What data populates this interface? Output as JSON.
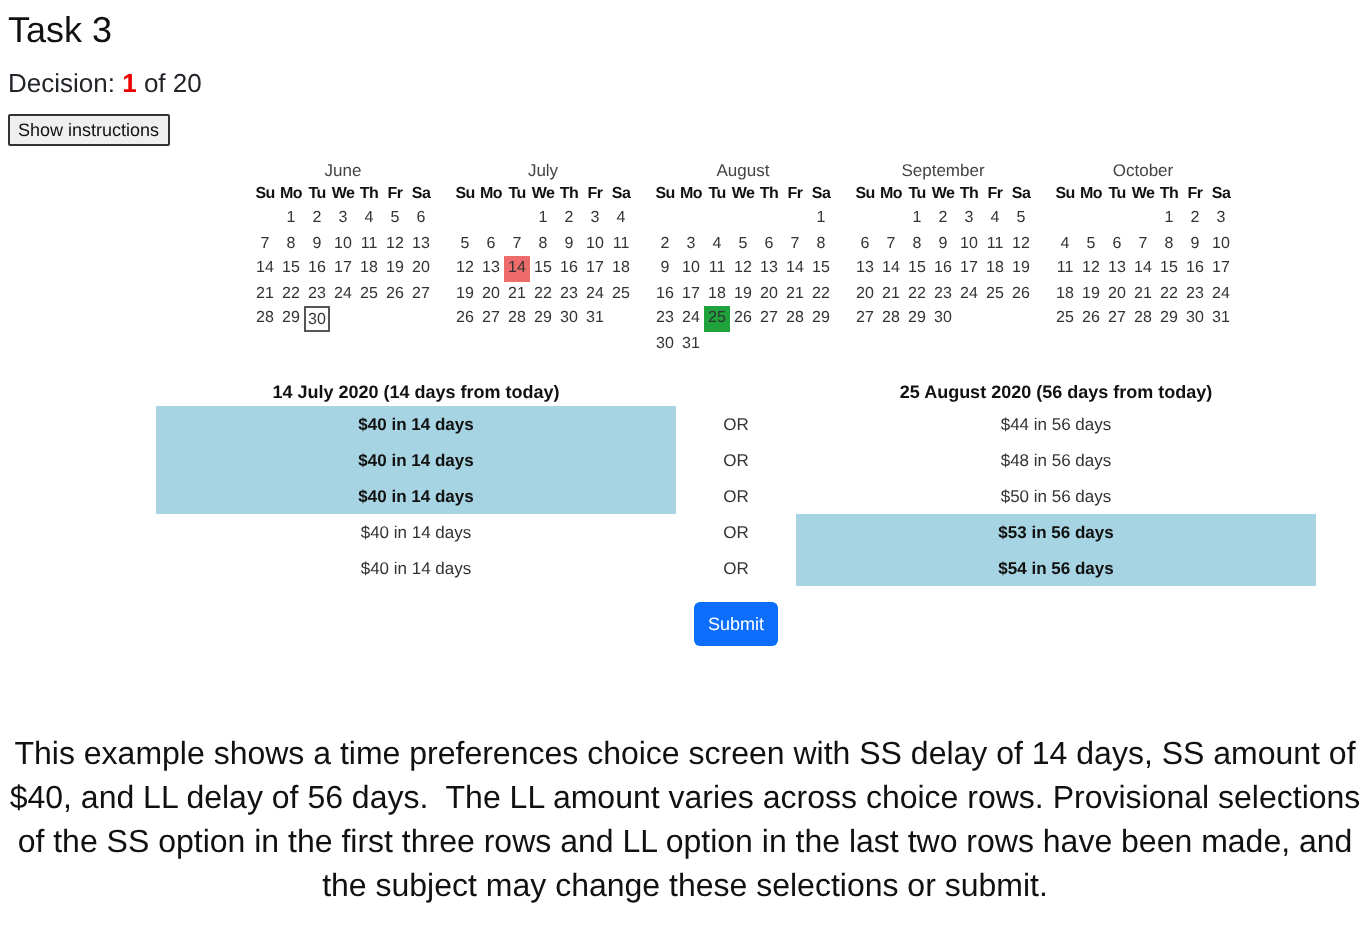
{
  "title": "Task 3",
  "decision": {
    "label": "Decision:",
    "current": "1",
    "of": "of 20"
  },
  "instructions_button": "Show instructions",
  "months": [
    {
      "name": "June",
      "weekdays": [
        "Su",
        "Mo",
        "Tu",
        "We",
        "Th",
        "Fr",
        "Sa"
      ],
      "weeks": [
        [
          "1",
          "2",
          "3",
          "4",
          "5",
          "6"
        ],
        [
          "7",
          "8",
          "9",
          "10",
          "11",
          "12",
          "13"
        ],
        [
          "14",
          "15",
          "16",
          "17",
          "18",
          "19",
          "20"
        ],
        [
          "21",
          "22",
          "23",
          "24",
          "25",
          "26",
          "27"
        ],
        [
          "28",
          "29",
          {
            "day": "30",
            "outlined": true
          }
        ]
      ]
    },
    {
      "name": "July",
      "weekdays": [
        "Su",
        "Mo",
        "Tu",
        "We",
        "Th",
        "Fr",
        "Sa"
      ],
      "weeks": [
        [
          "1",
          "2",
          "3",
          "4"
        ],
        [
          "5",
          "6",
          "7",
          "8",
          "9",
          "10",
          "11"
        ],
        [
          "12",
          "13",
          {
            "day": "14",
            "color": "#ee6b6b"
          },
          "15",
          "16",
          "17",
          "18"
        ],
        [
          "19",
          "20",
          "21",
          "22",
          "23",
          "24",
          "25"
        ],
        [
          "26",
          "27",
          "28",
          "29",
          "30",
          "31"
        ]
      ]
    },
    {
      "name": "August",
      "weekdays": [
        "Su",
        "Mo",
        "Tu",
        "We",
        "Th",
        "Fr",
        "Sa"
      ],
      "weeks": [
        [
          "1"
        ],
        [
          "2",
          "3",
          "4",
          "5",
          "6",
          "7",
          "8"
        ],
        [
          "9",
          "10",
          "11",
          "12",
          "13",
          "14",
          "15"
        ],
        [
          "16",
          "17",
          "18",
          "19",
          "20",
          "21",
          "22"
        ],
        [
          "23",
          "24",
          {
            "day": "25",
            "color": "#1fa33c"
          },
          "26",
          "27",
          "28",
          "29"
        ],
        [
          "30",
          "31"
        ]
      ]
    },
    {
      "name": "September",
      "weekdays": [
        "Su",
        "Mo",
        "Tu",
        "We",
        "Th",
        "Fr",
        "Sa"
      ],
      "weeks": [
        [
          "1",
          "2",
          "3",
          "4",
          "5"
        ],
        [
          "6",
          "7",
          "8",
          "9",
          "10",
          "11",
          "12"
        ],
        [
          "13",
          "14",
          "15",
          "16",
          "17",
          "18",
          "19"
        ],
        [
          "20",
          "21",
          "22",
          "23",
          "24",
          "25",
          "26"
        ],
        [
          "27",
          "28",
          "29",
          "30"
        ]
      ]
    },
    {
      "name": "October",
      "weekdays": [
        "Su",
        "Mo",
        "Tu",
        "We",
        "Th",
        "Fr",
        "Sa"
      ],
      "weeks": [
        [
          "1",
          "2",
          "3"
        ],
        [
          "4",
          "5",
          "6",
          "7",
          "8",
          "9",
          "10"
        ],
        [
          "11",
          "12",
          "13",
          "14",
          "15",
          "16",
          "17"
        ],
        [
          "18",
          "19",
          "20",
          "21",
          "22",
          "23",
          "24"
        ],
        [
          "25",
          "26",
          "27",
          "28",
          "29",
          "30",
          "31"
        ]
      ]
    }
  ],
  "choice": {
    "ss_header": "14 July 2020 (14 days from today)",
    "ll_header": "25 August 2020 (56 days from today)",
    "rows": [
      {
        "ss": {
          "text": "$40 in 14 days",
          "selected": true
        },
        "or": "OR",
        "ll": {
          "text": "$44 in 56 days",
          "selected": false
        }
      },
      {
        "ss": {
          "text": "$40 in 14 days",
          "selected": true
        },
        "or": "OR",
        "ll": {
          "text": "$48 in 56 days",
          "selected": false
        }
      },
      {
        "ss": {
          "text": "$40 in 14 days",
          "selected": true
        },
        "or": "OR",
        "ll": {
          "text": "$50 in 56 days",
          "selected": false
        }
      },
      {
        "ss": {
          "text": "$40 in 14 days",
          "selected": false
        },
        "or": "OR",
        "ll": {
          "text": "$53 in 56 days",
          "selected": true
        }
      },
      {
        "ss": {
          "text": "$40 in 14 days",
          "selected": false
        },
        "or": "OR",
        "ll": {
          "text": "$54 in 56 days",
          "selected": true
        }
      }
    ]
  },
  "submit_button": "Submit",
  "caption": "This example shows a time preferences choice screen with SS delay of 14 days, SS amount of $40, and LL delay of 56 days.  The LL amount varies across choice rows. Provisional selections of the SS option in the first three rows and LL option in the last two rows have been made, and the subject may change these selections or submit."
}
